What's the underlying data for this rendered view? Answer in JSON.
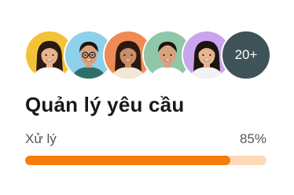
{
  "avatars": [
    {
      "name": "avatar-woman-yellow",
      "bg": "#f4c239",
      "skin": "#e8b48e",
      "hair": "#2a1a12",
      "shirt": "#ffffff",
      "long_hair": true,
      "glasses": false
    },
    {
      "name": "avatar-man-blue",
      "bg": "#8fd1ea",
      "skin": "#d9a17a",
      "hair": "#1c1410",
      "shirt": "#2f6f6a",
      "long_hair": false,
      "glasses": true
    },
    {
      "name": "avatar-woman-orange",
      "bg": "#f08a55",
      "skin": "#c98d67",
      "hair": "#2b1810",
      "shirt": "#f3e6d5",
      "long_hair": true,
      "glasses": false
    },
    {
      "name": "avatar-man-green",
      "bg": "#8fc7a8",
      "skin": "#d8a27c",
      "hair": "#1a120c",
      "shirt": "#ffffff",
      "long_hair": false,
      "glasses": false
    },
    {
      "name": "avatar-woman-purple",
      "bg": "#c9a4ef",
      "skin": "#e5b591",
      "hair": "#1e140e",
      "shirt": "#f2f2f2",
      "long_hair": true,
      "glasses": false
    }
  ],
  "more_count": "20+",
  "title": "Quản lý yêu cầu",
  "progress": {
    "label": "Xử lý",
    "value_text": "85%",
    "fraction": 0.85,
    "fill_color": "#f47d0c",
    "track_color": "#fdd9b8"
  }
}
